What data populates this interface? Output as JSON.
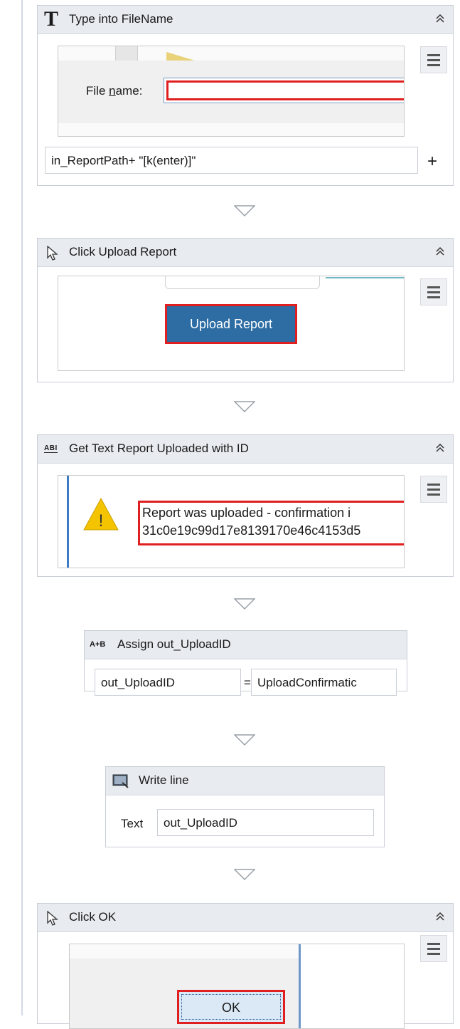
{
  "activities": {
    "type_into": {
      "title": "Type into FileName",
      "icon": "T",
      "label": "File name:",
      "label_mnemonic": "n",
      "expression": "in_ReportPath+ \"[k(enter)]\"",
      "plus": "+"
    },
    "click_upload": {
      "title": "Click Upload Report",
      "button_label": "Upload Report"
    },
    "get_text": {
      "title": "Get Text Report Uploaded with ID",
      "icon_text": "ABI",
      "warning_mark": "!",
      "line1": "Report was uploaded - confirmation i",
      "line2": "31c0e19c99d17e8139170e46c4153d5"
    },
    "assign": {
      "title": "Assign out_UploadID",
      "icon_text": "A+B",
      "left": "out_UploadID",
      "equals": "=",
      "right": "UploadConfirmatic"
    },
    "write_line": {
      "title": "Write line",
      "text_label": "Text",
      "text_value": "out_UploadID"
    },
    "click_ok": {
      "title": "Click OK",
      "button_label": "OK"
    }
  },
  "colors": {
    "header_bg": "#e8ebf0",
    "selection_red": "#e02020",
    "upload_button": "#2e6da4",
    "ok_button": "#dbe9f6",
    "warning_yellow": "#f5c400"
  }
}
